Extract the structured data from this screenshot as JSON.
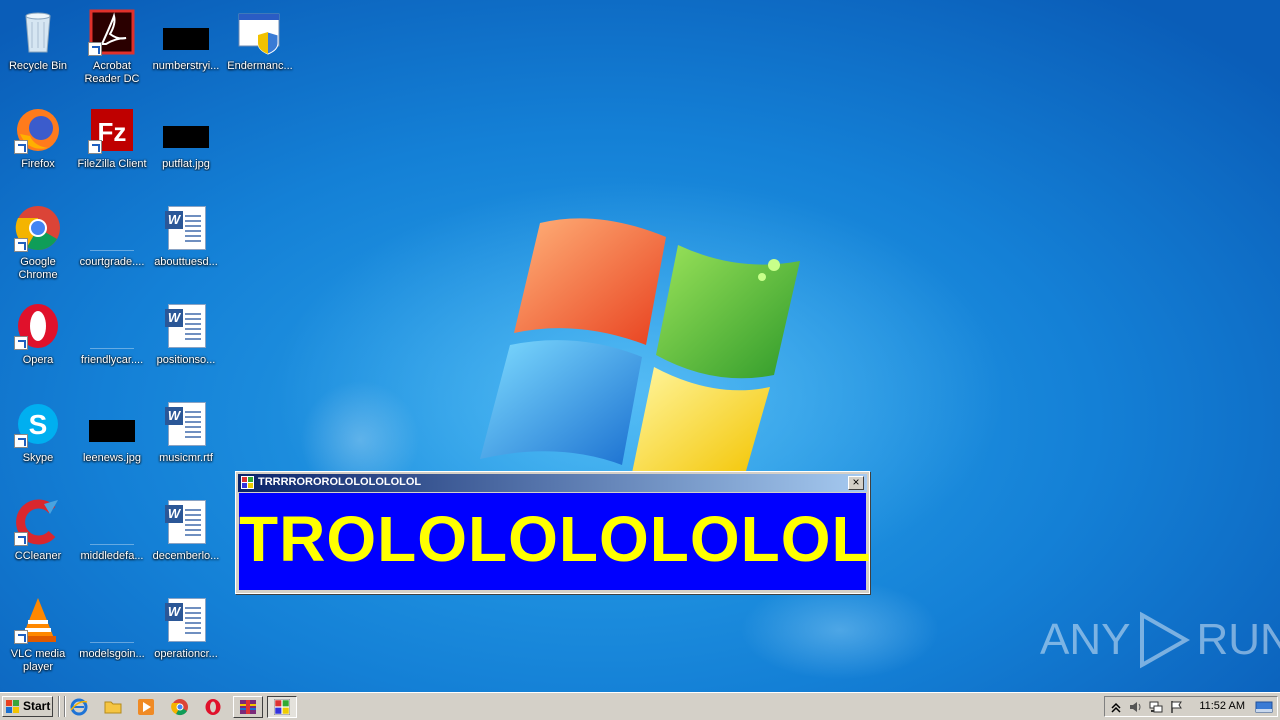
{
  "desktop": {
    "icons": [
      {
        "label": "Recycle Bin",
        "icon": "recycle-bin-icon"
      },
      {
        "label": "Acrobat Reader DC",
        "icon": "acrobat-reader-icon"
      },
      {
        "label": "numberstryi...",
        "icon": "image-file-icon"
      },
      {
        "label": "Endermanc...",
        "icon": "executable-shield-icon"
      },
      {
        "label": "Firefox",
        "icon": "firefox-icon"
      },
      {
        "label": "FileZilla Client",
        "icon": "filezilla-icon"
      },
      {
        "label": "putflat.jpg",
        "icon": "image-file-icon"
      },
      {
        "label": "Google Chrome",
        "icon": "chrome-icon"
      },
      {
        "label": "courtgrade....",
        "icon": "blank-file-icon"
      },
      {
        "label": "abouttuesd...",
        "icon": "word-document-icon"
      },
      {
        "label": "Opera",
        "icon": "opera-icon"
      },
      {
        "label": "friendlycar....",
        "icon": "blank-file-icon"
      },
      {
        "label": "positionso...",
        "icon": "word-document-icon"
      },
      {
        "label": "Skype",
        "icon": "skype-icon"
      },
      {
        "label": "leenews.jpg",
        "icon": "image-file-icon"
      },
      {
        "label": "musicmr.rtf",
        "icon": "word-document-icon"
      },
      {
        "label": "CCleaner",
        "icon": "ccleaner-icon"
      },
      {
        "label": "middledefa...",
        "icon": "blank-file-icon"
      },
      {
        "label": "decemberlo...",
        "icon": "word-document-icon"
      },
      {
        "label": "VLC media player",
        "icon": "vlc-icon"
      },
      {
        "label": "modelsgoin...",
        "icon": "blank-file-icon"
      },
      {
        "label": "operationcr...",
        "icon": "word-document-icon"
      }
    ]
  },
  "dialog": {
    "title": "TRRRROROROLOLOLOLOLOL",
    "message": "TROLOLOLOLOLOL",
    "close_label": "×",
    "colors": {
      "background": "#0000ff",
      "text": "#ffff00"
    }
  },
  "watermark": {
    "text_left": "ANY",
    "text_right": "RUN"
  },
  "taskbar": {
    "start_label": "Start",
    "quick_launch": [
      "internet-explorer-icon",
      "folder-icon",
      "media-player-icon",
      "chrome-icon",
      "opera-icon"
    ],
    "tasks": [
      "winrar-task-icon",
      "dialog-app-task-icon"
    ],
    "clock": "11:52 AM"
  }
}
